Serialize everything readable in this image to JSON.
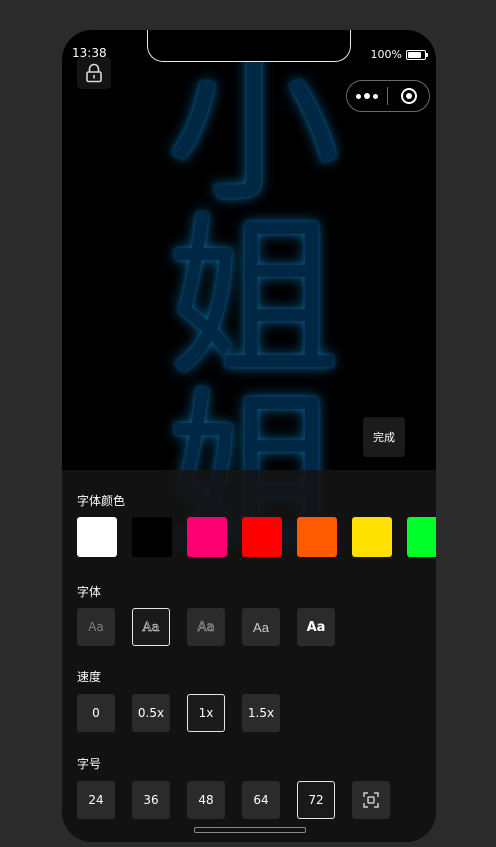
{
  "status": {
    "time": "13:38",
    "battery": "100%"
  },
  "marquee": {
    "text": "小姐姐"
  },
  "done_label": "完成",
  "sections": {
    "color_title": "字体颜色",
    "font_title": "字体",
    "speed_title": "速度",
    "size_title": "字号"
  },
  "colors": [
    "#ffffff",
    "#000000",
    "#ff0073",
    "#ff0000",
    "#ff5a00",
    "#ffe000",
    "#00ff2a"
  ],
  "fonts": [
    "Aa",
    "Aa",
    "Aa",
    "Aa",
    "Aa"
  ],
  "speeds": [
    "0",
    "0.5x",
    "1x",
    "1.5x"
  ],
  "sizes": [
    "24",
    "36",
    "48",
    "64",
    "72"
  ],
  "icons": {
    "lock": "lock-icon",
    "more": "more-dots-icon",
    "close": "target-icon",
    "fullscreen": "fullscreen-icon"
  }
}
